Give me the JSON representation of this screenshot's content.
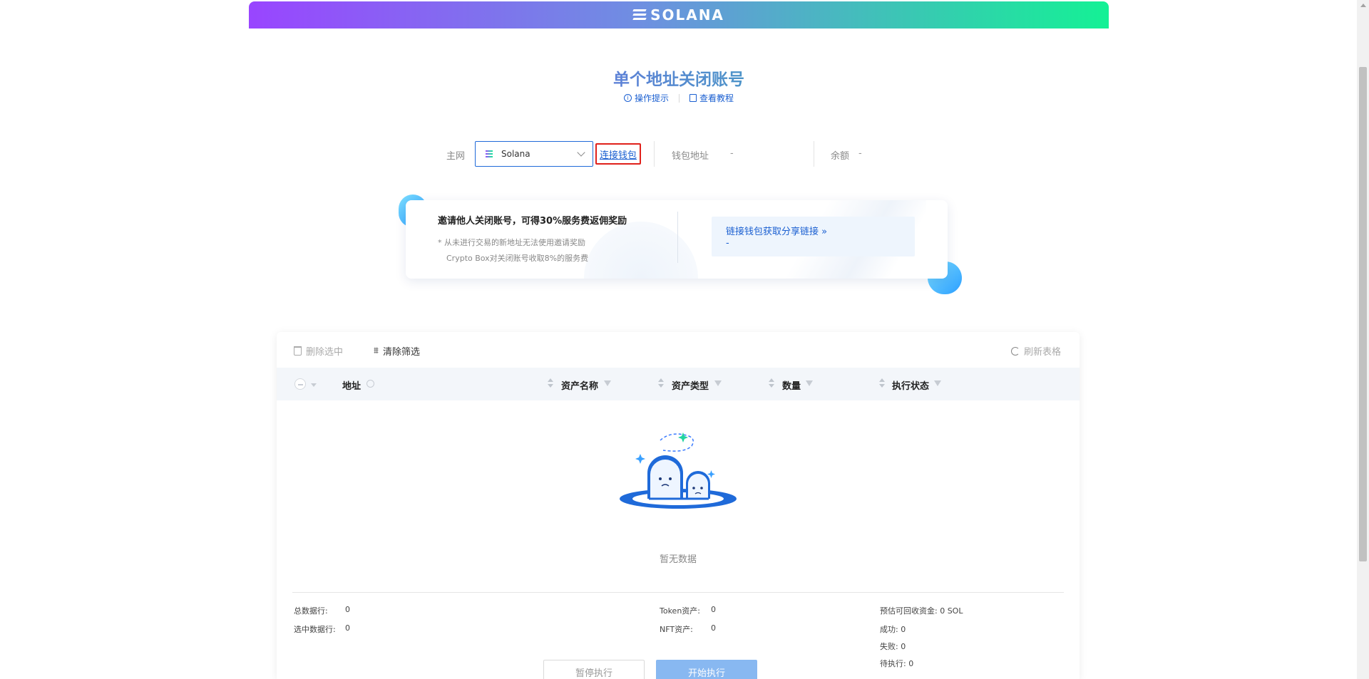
{
  "header": {
    "logo_text": "SOLANA"
  },
  "page": {
    "title": "单个地址关闭账号",
    "help": {
      "tips": "操作提示",
      "tutorial": "查看教程"
    }
  },
  "network": {
    "label": "主网",
    "selected": "Solana",
    "connect_label": "连接钱包",
    "wallet_label": "钱包地址",
    "wallet_value": "-",
    "balance_label": "余额",
    "balance_value": "-"
  },
  "promo": {
    "title": "邀请他人关闭账号，可得30%服务费返佣奖励",
    "notes": [
      "* 从未进行交易的新地址无法使用邀请奖励",
      "Crypto Box对关闭账号收取8%的服务费"
    ],
    "share_link": "链接钱包获取分享链接 »",
    "share_value": "-"
  },
  "toolbar": {
    "delete_selected": "删除选中",
    "clear_filter": "清除筛选",
    "refresh": "刷新表格"
  },
  "table": {
    "columns": [
      "地址",
      "资产名称",
      "资产类型",
      "数量",
      "执行状态"
    ],
    "empty_text": "暂无数据"
  },
  "stats": {
    "total_rows_label": "总数据行:",
    "total_rows_value": "0",
    "selected_rows_label": "选中数据行:",
    "selected_rows_value": "0",
    "token_label": "Token资产:",
    "token_value": "0",
    "nft_label": "NFT资产:",
    "nft_value": "0",
    "recoverable": "预估可回收资金: 0 SOL",
    "success": "成功: 0",
    "failed": "失败: 0",
    "pending": "待执行: 0"
  },
  "actions": {
    "pause": "暂停执行",
    "start": "开始执行"
  },
  "colors": {
    "accent": "#1a5fd1",
    "highlight_border": "#e0211b",
    "start_button": "#88b8f1"
  }
}
